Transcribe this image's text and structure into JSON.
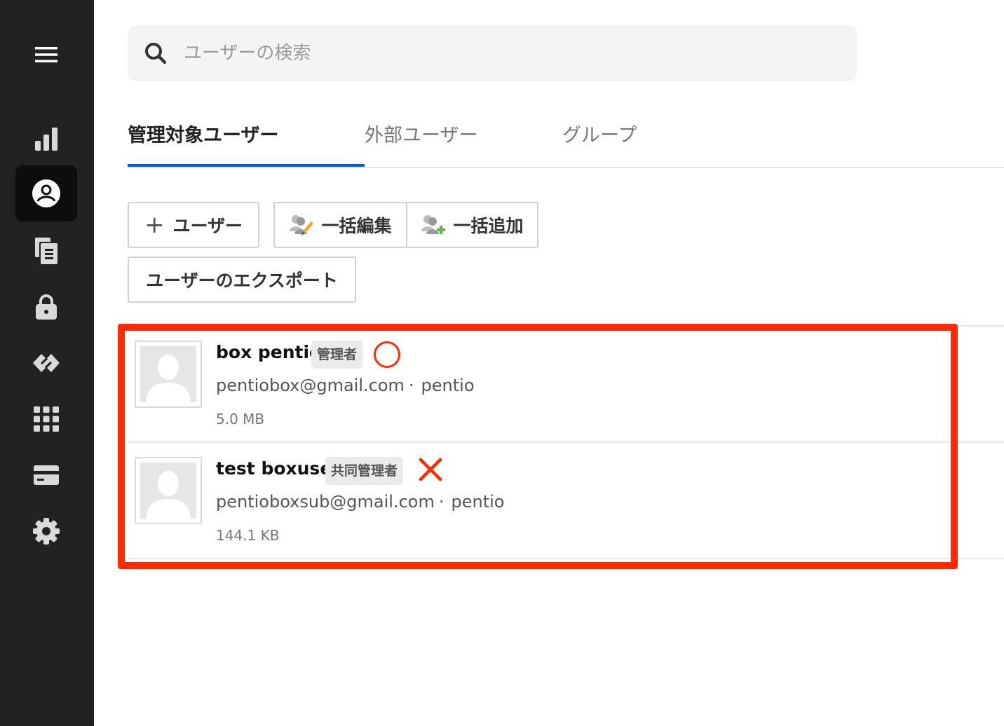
{
  "search": {
    "placeholder": "ユーザーの検索"
  },
  "tabs": [
    {
      "label": "管理対象ユーザー",
      "active": true
    },
    {
      "label": "外部ユーザー",
      "active": false
    },
    {
      "label": "グループ",
      "active": false
    }
  ],
  "toolbar": {
    "add_user_label": "ユーザー",
    "bulk_edit_label": "一括編集",
    "bulk_add_label": "一括追加",
    "export_label": "ユーザーのエクスポート"
  },
  "users": [
    {
      "name": "box pentio",
      "role": "管理者",
      "email": "pentiobox@gmail.com",
      "separator": "·",
      "enterprise": "pentio",
      "storage": "5.0 MB",
      "mark": "circle-icon"
    },
    {
      "name": "test boxuser",
      "role": "共同管理者",
      "email": "pentioboxsub@gmail.com",
      "separator": "·",
      "enterprise": "pentio",
      "storage": "144.1 KB",
      "mark": "cross-icon"
    }
  ],
  "colors": {
    "sidebar": "#222222",
    "accent": "#0061d5",
    "highlight": "#ff2a00"
  },
  "sidebar": {
    "items": [
      {
        "icon": "menu-icon"
      },
      {
        "icon": "bar-chart-icon"
      },
      {
        "icon": "user-icon",
        "active": true
      },
      {
        "icon": "documents-icon"
      },
      {
        "icon": "lock-icon"
      },
      {
        "icon": "relay-icon"
      },
      {
        "icon": "apps-grid-icon"
      },
      {
        "icon": "billing-card-icon"
      },
      {
        "icon": "gear-icon"
      }
    ]
  }
}
